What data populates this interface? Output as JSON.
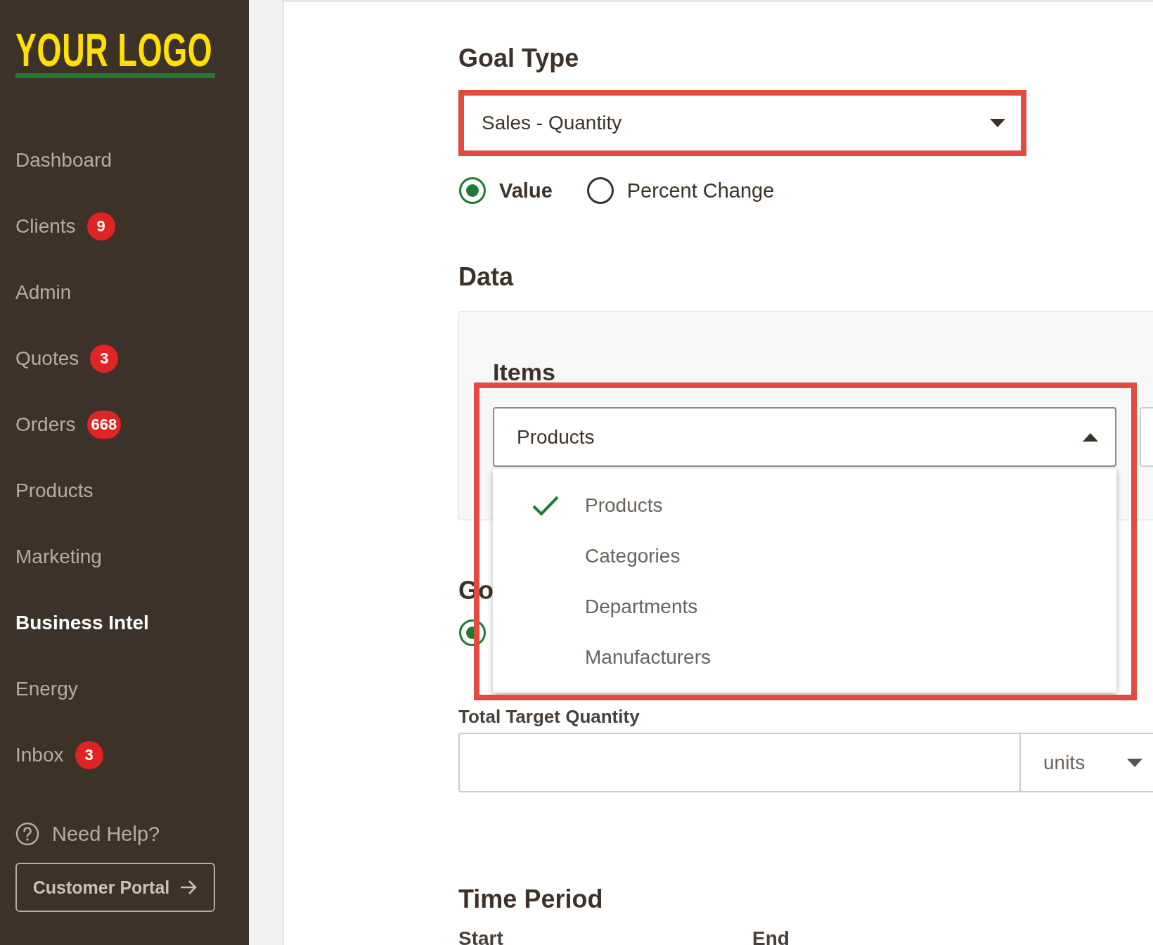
{
  "logo": {
    "text": "YOUR LOGO"
  },
  "sidebar": {
    "items": [
      {
        "label": "Dashboard",
        "selected": false
      },
      {
        "label": "Clients",
        "badge": "9",
        "selected": false
      },
      {
        "label": "Admin",
        "selected": false
      },
      {
        "label": "Quotes",
        "badge": "3",
        "selected": false
      },
      {
        "label": "Orders",
        "badge": "668",
        "selected": false
      },
      {
        "label": "Products",
        "selected": false
      },
      {
        "label": "Marketing",
        "selected": false
      },
      {
        "label": "Business Intel",
        "selected": true
      },
      {
        "label": "Energy",
        "selected": false
      },
      {
        "label": "Inbox",
        "badge": "3",
        "selected": false
      }
    ],
    "help": {
      "label": "Need Help?"
    },
    "portal_button": {
      "label": "Customer Portal"
    }
  },
  "goal_type": {
    "heading": "Goal Type",
    "select": {
      "value": "Sales - Quantity",
      "highlighted": true
    },
    "radios": [
      {
        "label": "Value",
        "selected": true
      },
      {
        "label": "Percent Change",
        "selected": false
      }
    ]
  },
  "data": {
    "heading": "Data",
    "items": {
      "heading": "Items",
      "select": {
        "value": "Products",
        "expanded": true,
        "highlighted": true
      },
      "options": [
        {
          "label": "Products",
          "selected": true
        },
        {
          "label": "Categories",
          "selected": false
        },
        {
          "label": "Departments",
          "selected": false
        },
        {
          "label": "Manufacturers",
          "selected": false
        }
      ]
    }
  },
  "goal": {
    "heading": "Go",
    "radio": {
      "selected": true
    }
  },
  "target": {
    "label": "Total Target Quantity",
    "unit": "units"
  },
  "time_period": {
    "heading": "Time Period",
    "start_label": "Start",
    "end_label": "End"
  }
}
